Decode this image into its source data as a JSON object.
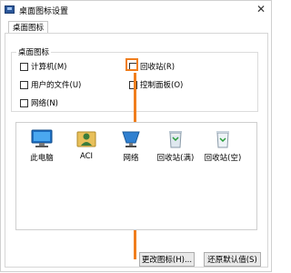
{
  "window": {
    "title": "桌面图标设置",
    "close_label": "✕"
  },
  "tabs": [
    {
      "label": "桌面图标"
    }
  ],
  "group": {
    "label": "桌面图标",
    "checkboxes": [
      {
        "label": "计算机(M)",
        "checked": false
      },
      {
        "label": "回收站(R)",
        "checked": false
      },
      {
        "label": "用户的文件(U)",
        "checked": false
      },
      {
        "label": "控制面板(O)",
        "checked": false
      },
      {
        "label": "网络(N)",
        "checked": false
      }
    ]
  },
  "icons": [
    {
      "label": "此电脑",
      "icon": "computer-icon"
    },
    {
      "label": "ACI",
      "icon": "user-folder-icon"
    },
    {
      "label": "网络",
      "icon": "network-icon"
    },
    {
      "label": "回收站(满)",
      "icon": "recycle-bin-full-icon"
    },
    {
      "label": "回收站(空)",
      "icon": "recycle-bin-empty-icon"
    }
  ],
  "buttons": {
    "change_icon": "更改图标(H)...",
    "restore_default": "还原默认值(S)"
  },
  "colors": {
    "highlight": "#f07e1d",
    "accent": "#2b579a"
  }
}
